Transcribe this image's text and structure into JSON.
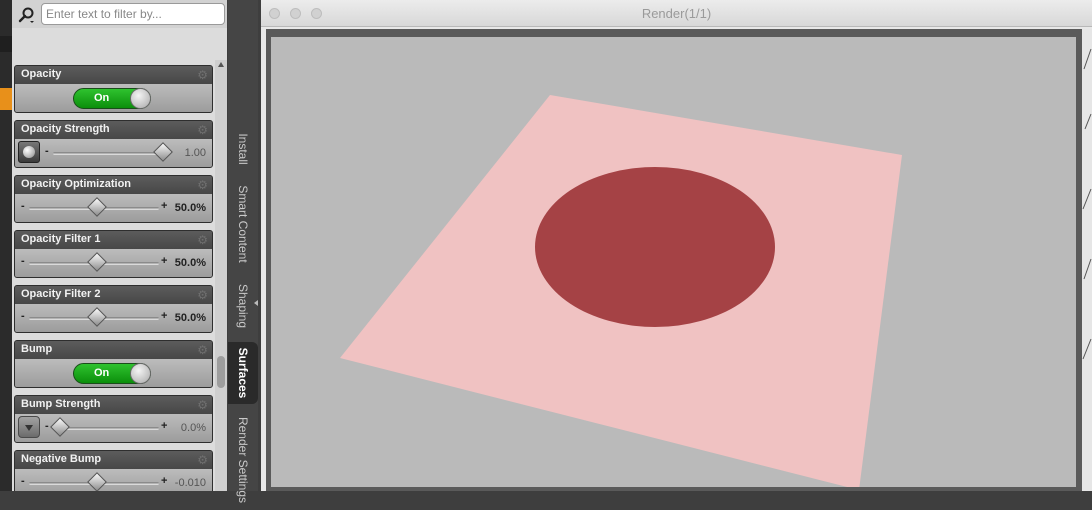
{
  "filter": {
    "placeholder": "Enter text to filter by..."
  },
  "properties": [
    {
      "title": "Opacity",
      "kind": "toggle",
      "state": "On"
    },
    {
      "title": "Opacity Strength",
      "kind": "slider-map",
      "value": "1.00",
      "fraction": 1.0
    },
    {
      "title": "Opacity Optimization",
      "kind": "slider",
      "value": "50.0%",
      "fraction": 0.5
    },
    {
      "title": "Opacity Filter 1",
      "kind": "slider",
      "value": "50.0%",
      "fraction": 0.5
    },
    {
      "title": "Opacity Filter 2",
      "kind": "slider",
      "value": "50.0%",
      "fraction": 0.5
    },
    {
      "title": "Bump",
      "kind": "toggle",
      "state": "On"
    },
    {
      "title": "Bump Strength",
      "kind": "slider-map2",
      "value": "0.0%",
      "fraction": 0.0
    },
    {
      "title": "Negative Bump",
      "kind": "slider",
      "value": "-0.010",
      "fraction": 0.5
    }
  ],
  "tabs": [
    {
      "label": "Install",
      "active": false
    },
    {
      "label": "Smart Content",
      "active": false
    },
    {
      "label": "Shaping",
      "active": false
    },
    {
      "label": "Surfaces",
      "active": true
    },
    {
      "label": "Render Settings",
      "active": false
    }
  ],
  "window": {
    "title": "Render(1/1)"
  },
  "render": {
    "background_color": "#bababa",
    "plane_color": "#f0c2c2",
    "disc_color": "#a54245"
  },
  "icons": {
    "filter": "search-filter-icon",
    "gear": "gear-icon"
  },
  "colors": {
    "toggle_on": "#16a316",
    "active_tab": "#2a2a2a"
  }
}
